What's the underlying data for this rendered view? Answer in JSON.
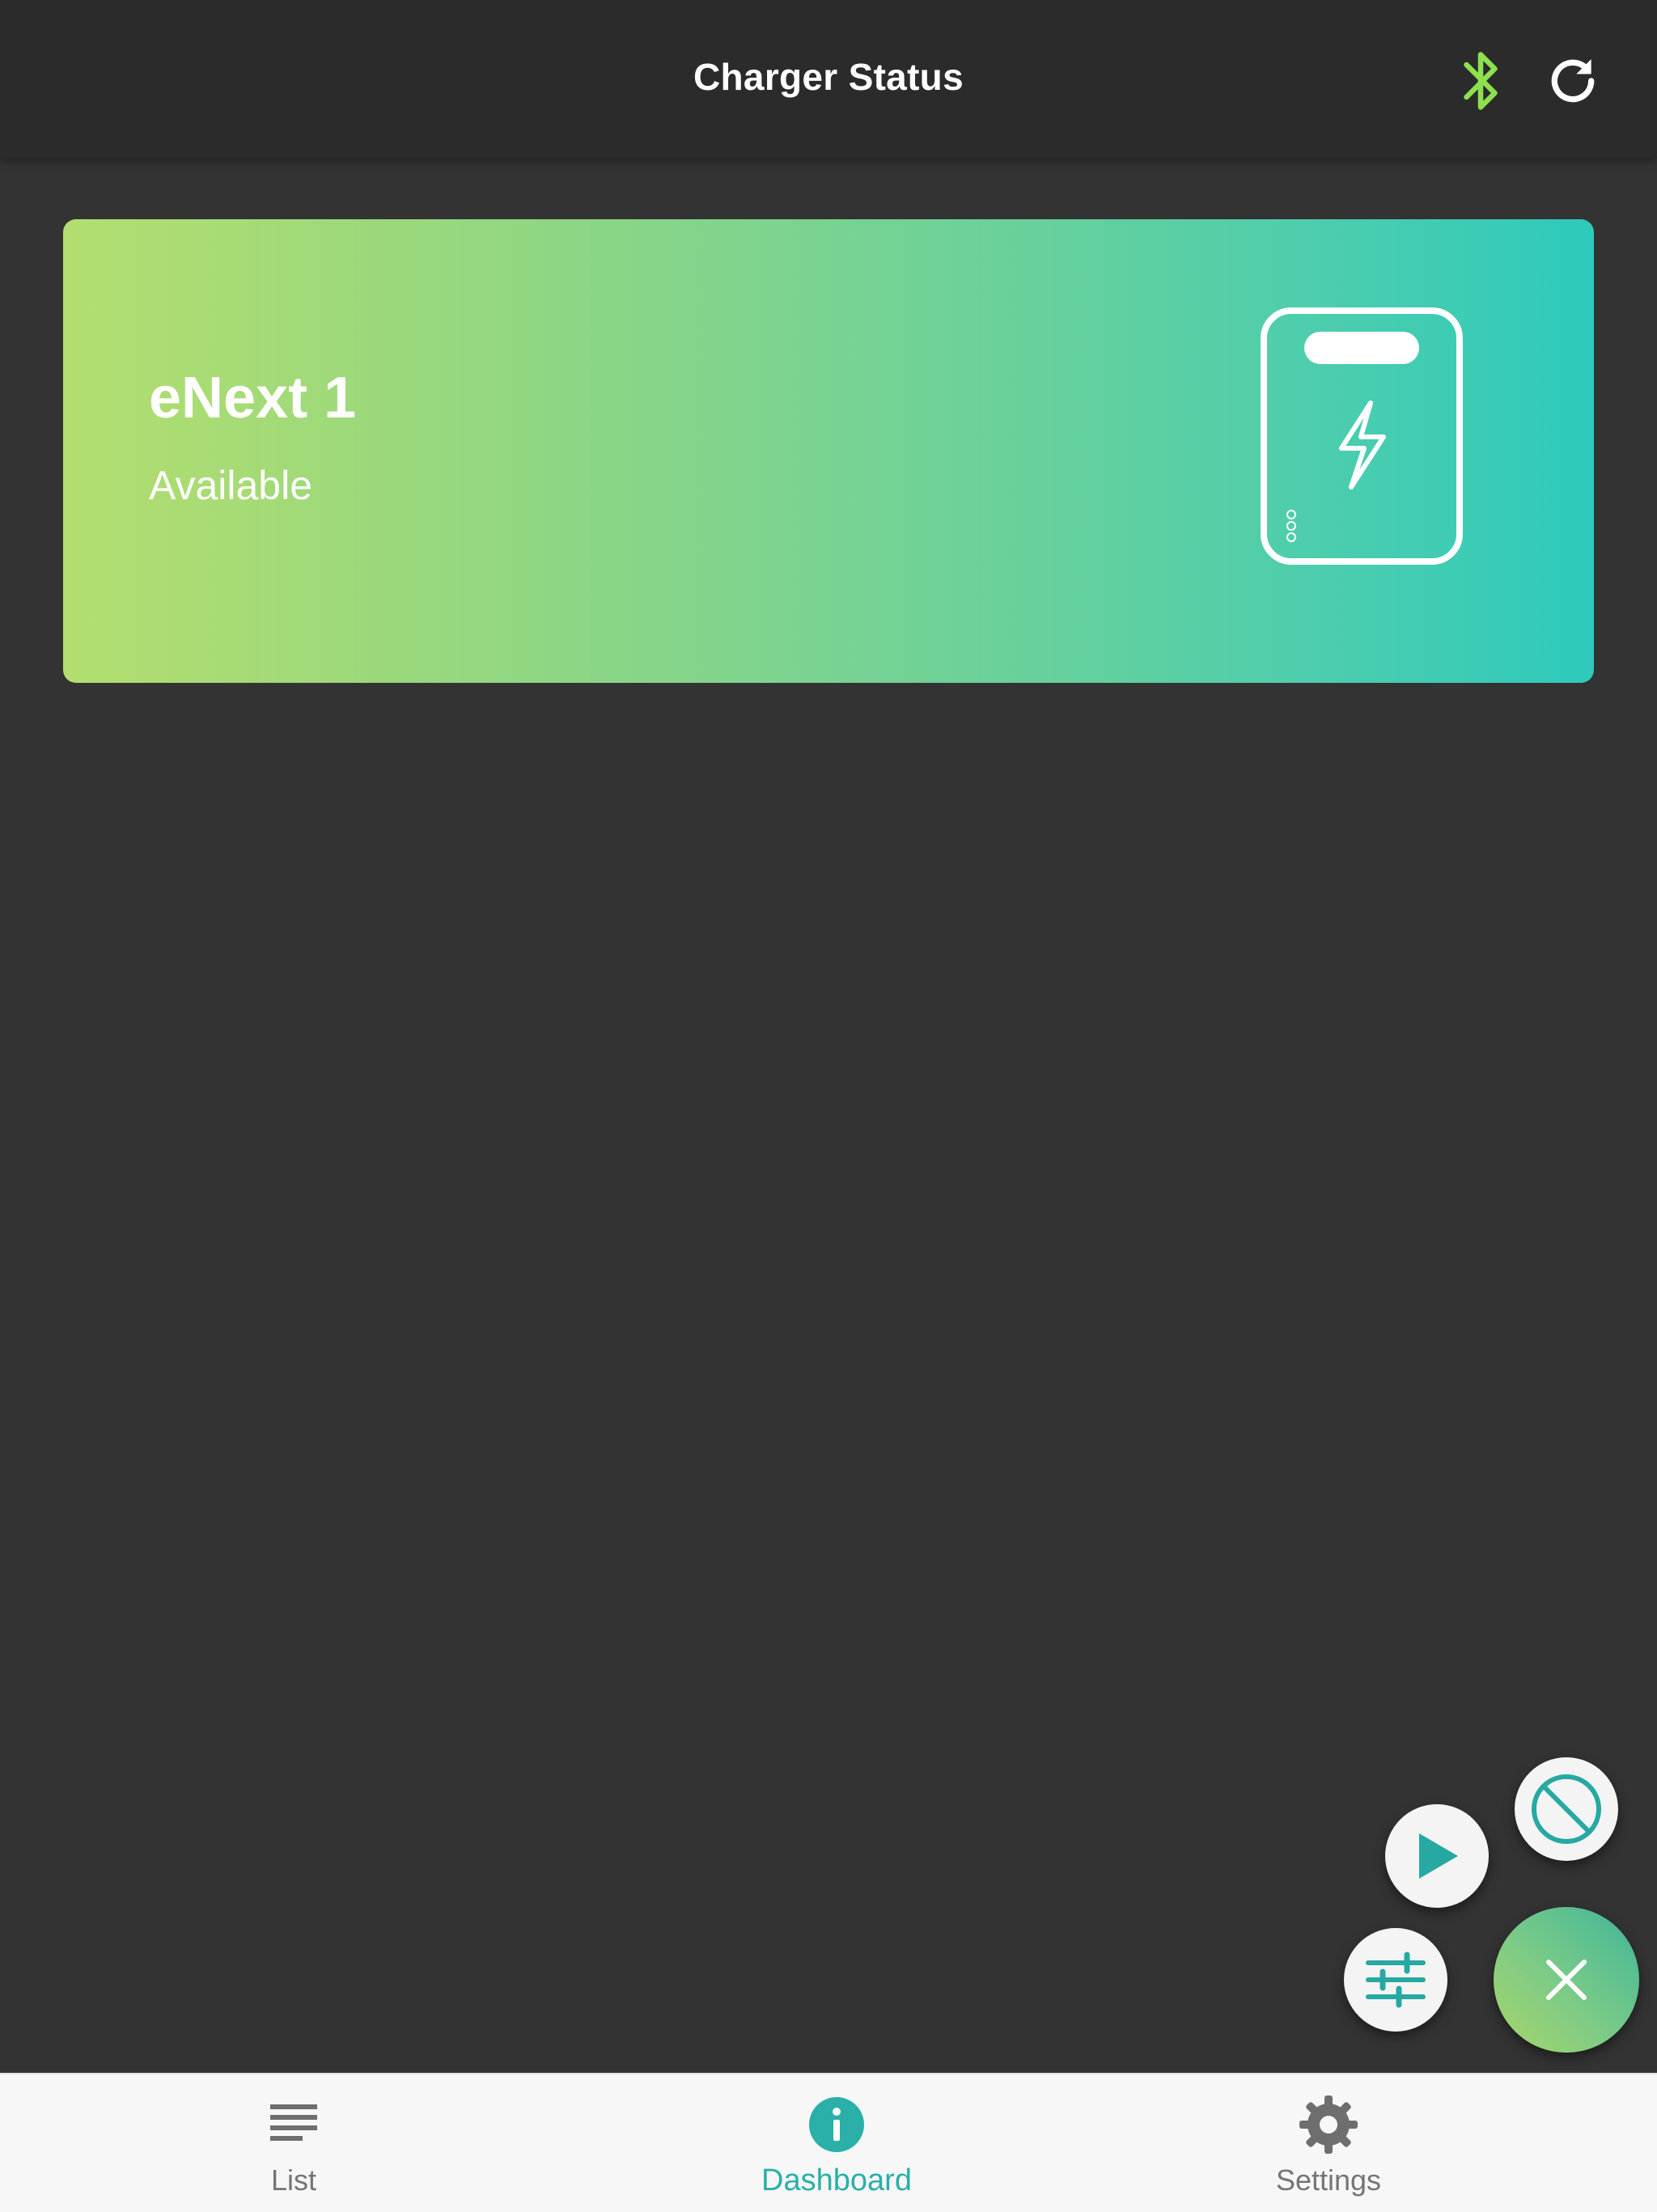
{
  "header": {
    "title": "Charger Status",
    "bluetooth_icon": "bluetooth-icon",
    "refresh_icon": "refresh-icon",
    "bluetooth_color": "#8de04e"
  },
  "charger_card": {
    "name": "eNext 1",
    "status": "Available",
    "icon": "charger-icon",
    "gradient_start": "#b3de6f",
    "gradient_end": "#2ecabc"
  },
  "fabs": {
    "stop_icon": "block-icon",
    "play_icon": "play-icon",
    "adjust_icon": "sliders-icon",
    "close_icon": "close-icon"
  },
  "bottom_nav": {
    "items": [
      {
        "label": "List",
        "icon": "list-icon",
        "active": false
      },
      {
        "label": "Dashboard",
        "icon": "info-icon",
        "active": true
      },
      {
        "label": "Settings",
        "icon": "gear-icon",
        "active": false
      }
    ],
    "active_color": "#2ab0a8",
    "inactive_color": "#757575"
  }
}
